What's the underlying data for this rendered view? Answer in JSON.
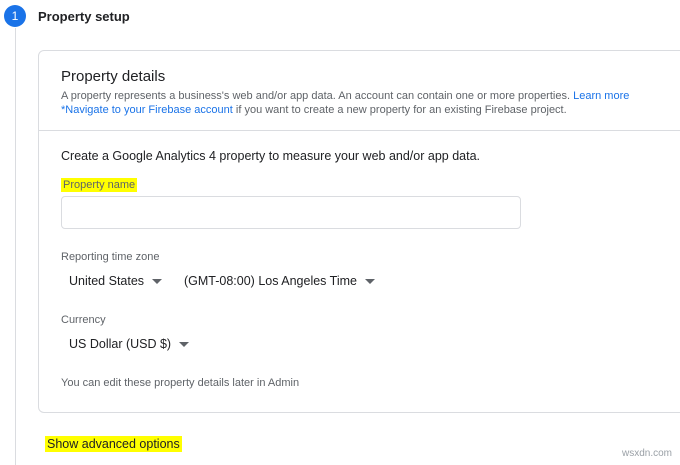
{
  "step": {
    "number": "1",
    "title": "Property setup"
  },
  "details": {
    "title": "Property details",
    "desc_line1": "A property represents a business's web and/or app data. An account can contain one or more properties.",
    "learn_more": "Learn more",
    "firebase_link": "*Navigate to your Firebase account",
    "desc_line2_rest": "if you want to create a new property for an existing Firebase project."
  },
  "form": {
    "intro": "Create a Google Analytics 4 property to measure your web and/or app data.",
    "property_name_label": "Property name",
    "property_name_value": "",
    "timezone_label": "Reporting time zone",
    "country_value": "United States",
    "timezone_value": "(GMT-08:00) Los Angeles Time",
    "currency_label": "Currency",
    "currency_value": "US Dollar (USD $)",
    "footnote": "You can edit these property details later in Admin"
  },
  "advanced_label": "Show advanced options",
  "watermark": "wsxdn.com",
  "colors": {
    "accent": "#1a73e8",
    "highlight": "#ffff00"
  }
}
